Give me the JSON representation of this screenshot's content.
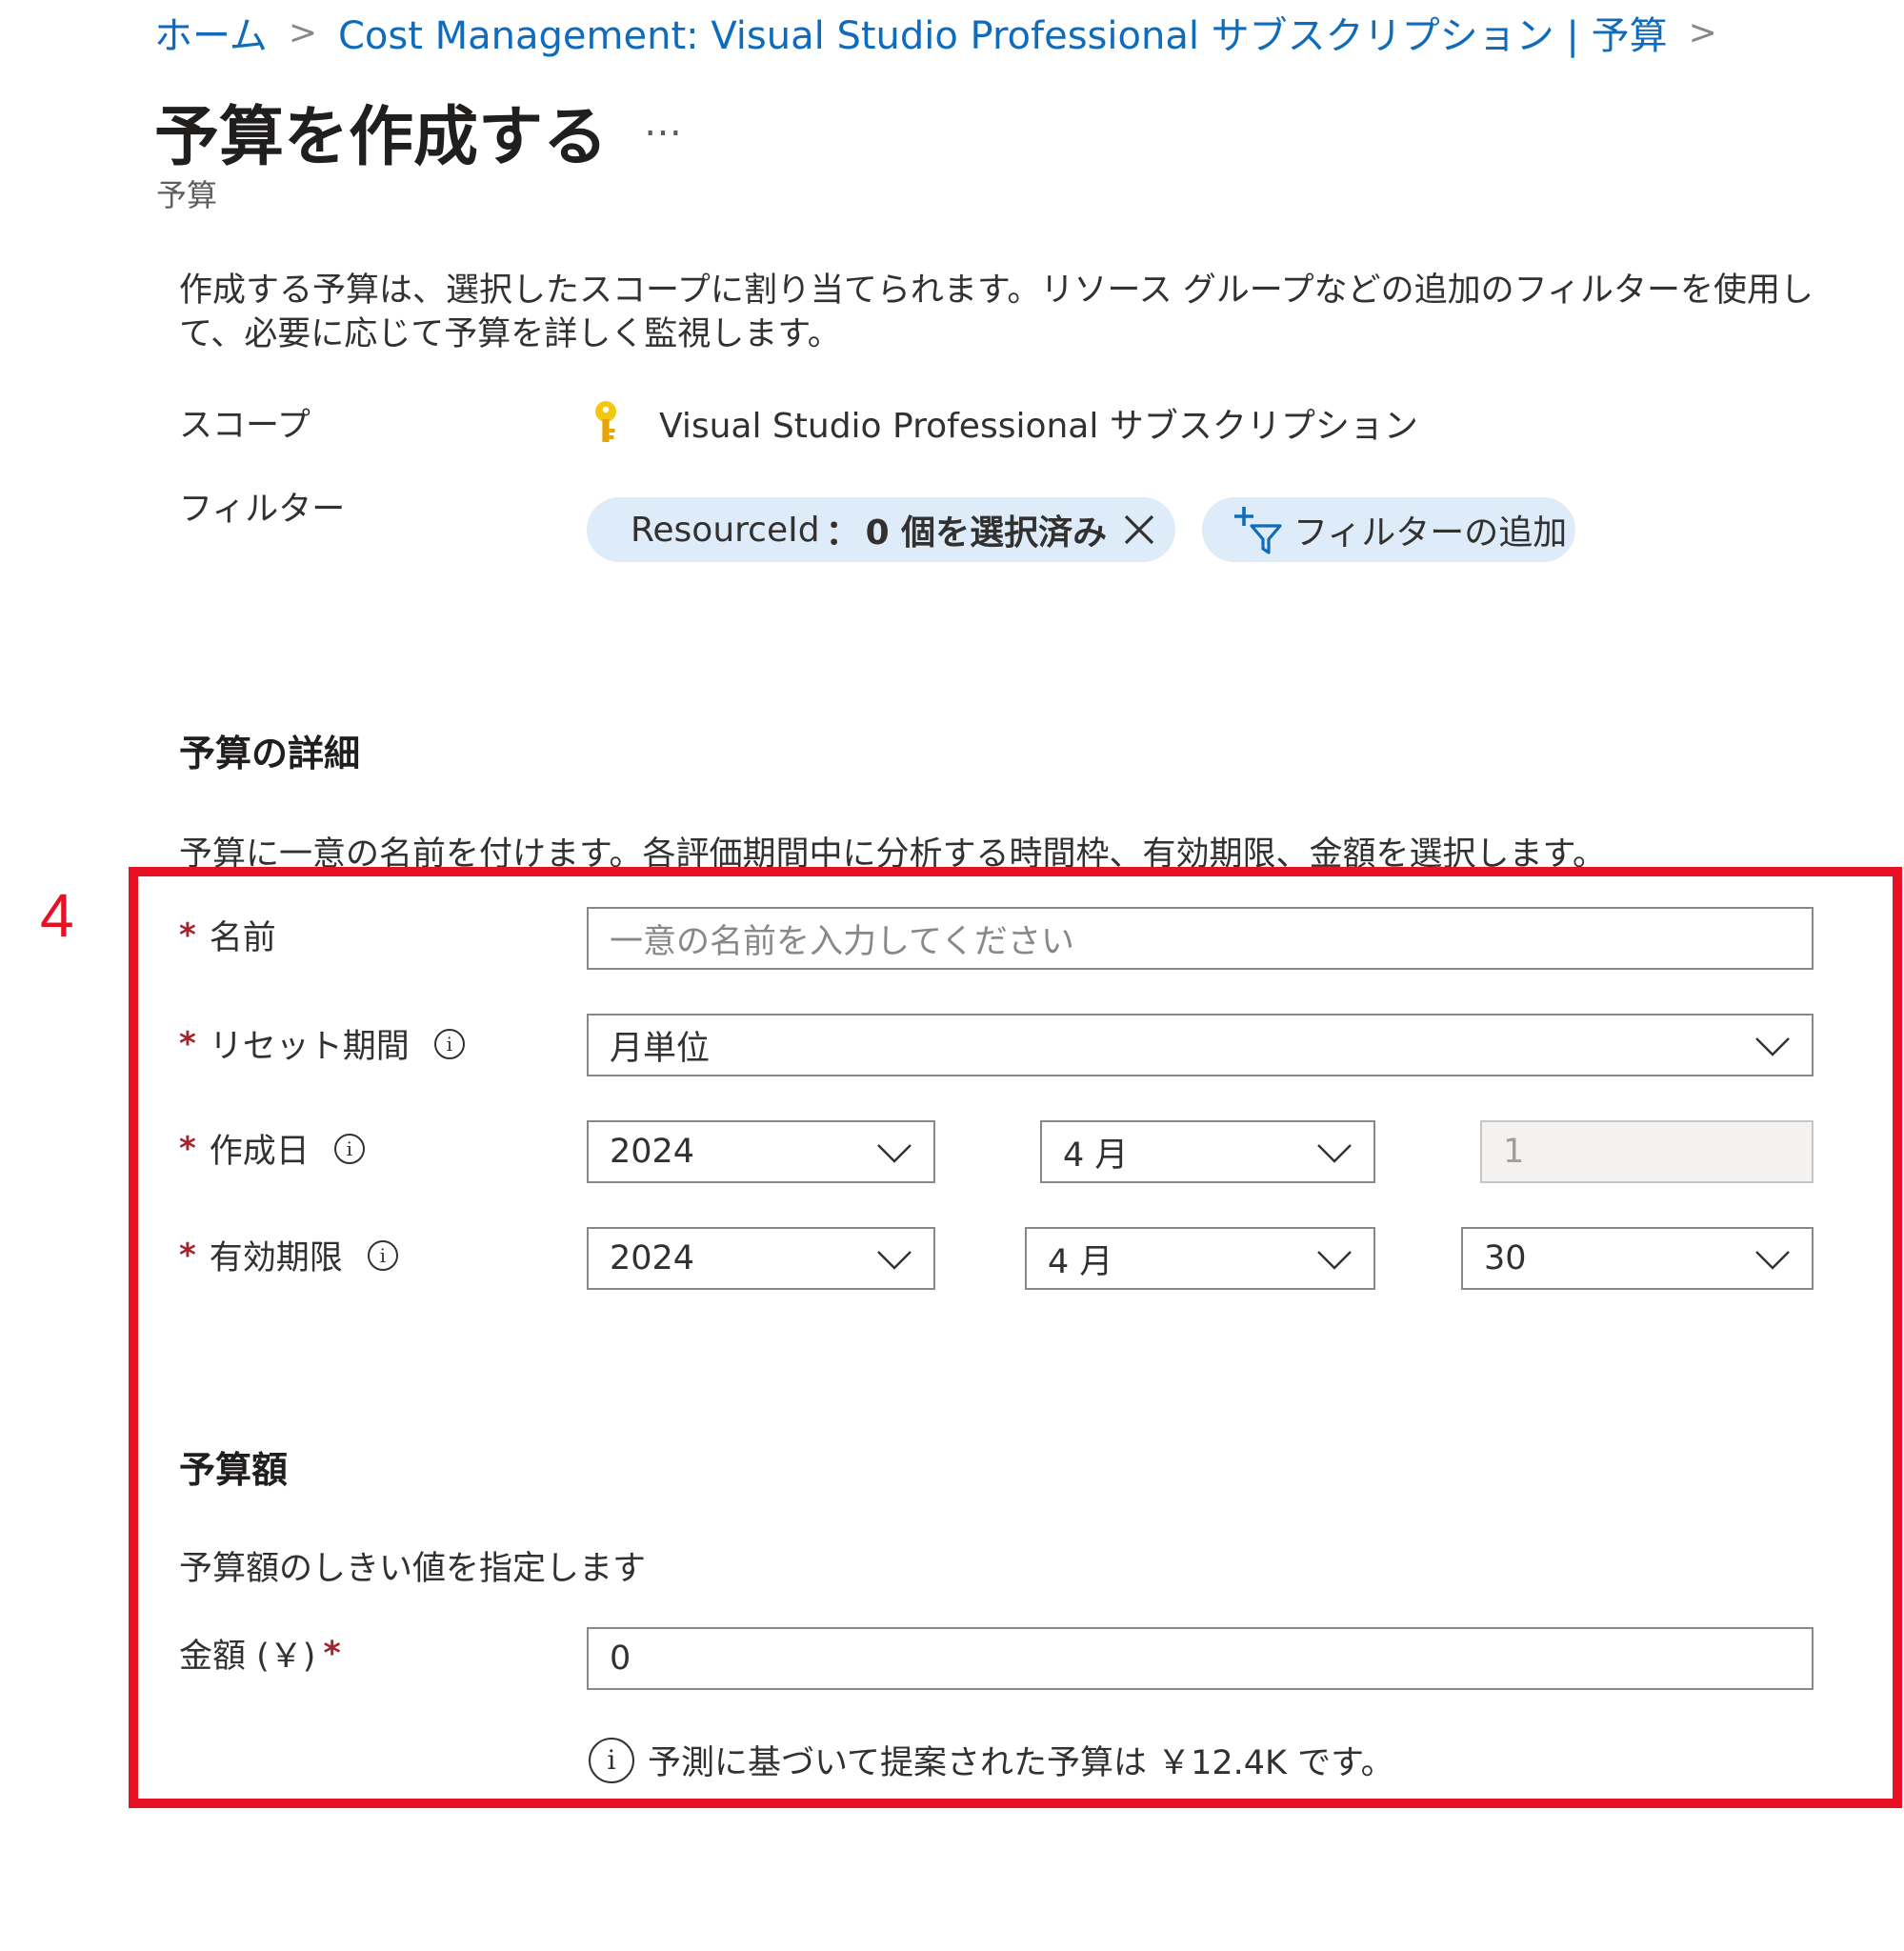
{
  "breadcrumb": {
    "items": [
      "ホーム",
      "Cost Management: Visual Studio Professional サブスクリプション | 予算"
    ],
    "separator": ">"
  },
  "header": {
    "title": "予算を作成する",
    "more": "…",
    "subtitle": "予算"
  },
  "intro": {
    "text": "作成する予算は、選択したスコープに割り当てられます。リソース グループなどの追加のフィルターを使用して、必要に応じて予算を詳しく監視します。"
  },
  "scope": {
    "label": "スコープ",
    "icon": "key-icon",
    "value": "Visual Studio Professional サブスクリプション"
  },
  "filter": {
    "label": "フィルター",
    "resource_pill": {
      "key": "ResourceId",
      "colon": "：",
      "value": "0 個を選択済み"
    },
    "add_button": "フィルターの追加"
  },
  "details": {
    "title": "予算の詳細",
    "description": "予算に一意の名前を付けます。各評価期間中に分析する時間枠、有効期限、金額を選択します。",
    "required_mark": "*",
    "name": {
      "label": "名前",
      "placeholder": "一意の名前を入力してください"
    },
    "reset_period": {
      "label": "リセット期間",
      "value": "月単位"
    },
    "creation_date": {
      "label": "作成日",
      "year": "2024",
      "month": "4 月",
      "day": "1"
    },
    "expiration": {
      "label": "有効期限",
      "year": "2024",
      "month": "4 月",
      "day": "30"
    }
  },
  "amount": {
    "title": "予算額",
    "description": "予算額のしきい値を指定します",
    "label": "金額 (￥)",
    "required_mark": "*",
    "value": "0",
    "hint": "予測に基づいて提案された予算は ￥12.4K です。"
  },
  "annotation": {
    "step_number": "4",
    "color": "#e81123"
  },
  "colors": {
    "link": "#0f6cbd",
    "pill_bg": "#deecf9",
    "required": "#a4262c"
  }
}
